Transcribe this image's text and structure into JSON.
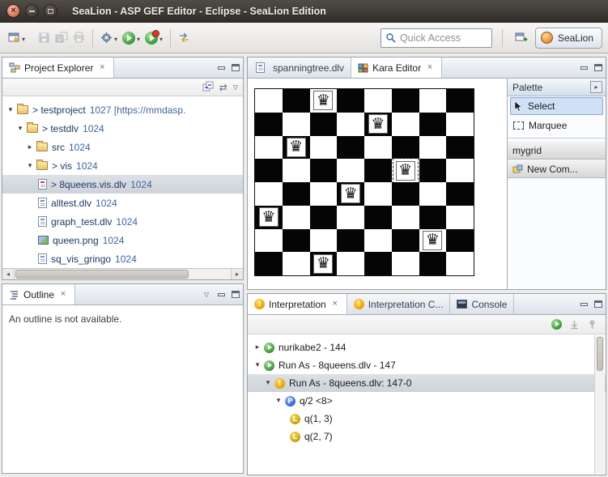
{
  "window": {
    "title": "SeaLion - ASP GEF Editor - Eclipse - SeaLion Edition"
  },
  "toolbar": {
    "quick_access": "Quick Access",
    "perspective": "SeaLion"
  },
  "project_explorer": {
    "title": "Project Explorer",
    "items": [
      {
        "label": "> testproject",
        "decoration": "1027 [https://mmdasp."
      },
      {
        "label": "> testdlv",
        "decoration": "1024"
      },
      {
        "label": "src",
        "decoration": "1024"
      },
      {
        "label": "> vis",
        "decoration": "1024"
      },
      {
        "label": "> 8queens.vis.dlv",
        "decoration": "1024"
      },
      {
        "label": "alltest.dlv",
        "decoration": "1024"
      },
      {
        "label": "graph_test.dlv",
        "decoration": "1024"
      },
      {
        "label": "queen.png",
        "decoration": "1024"
      },
      {
        "label": "sq_vis_gringo",
        "decoration": "1024"
      }
    ]
  },
  "outline": {
    "title": "Outline",
    "message": "An outline is not available."
  },
  "editor": {
    "tabs": [
      {
        "label": "spanningtree.dlv"
      },
      {
        "label": "Kara Editor"
      }
    ],
    "board": {
      "rows": 8,
      "cols": 8,
      "queen_symbol": "♛",
      "queens": [
        {
          "row": 1,
          "col": 3
        },
        {
          "row": 2,
          "col": 5
        },
        {
          "row": 3,
          "col": 2
        },
        {
          "row": 4,
          "col": 6,
          "selected": true
        },
        {
          "row": 5,
          "col": 4
        },
        {
          "row": 6,
          "col": 1
        },
        {
          "row": 7,
          "col": 7
        },
        {
          "row": 8,
          "col": 3
        }
      ]
    }
  },
  "palette": {
    "title": "Palette",
    "tools": [
      {
        "label": "Select"
      },
      {
        "label": "Marquee"
      }
    ],
    "drawers": [
      {
        "label": "mygrid"
      },
      {
        "label": "New Com..."
      }
    ]
  },
  "interpretation": {
    "tabs": [
      {
        "label": "Interpretation"
      },
      {
        "label": "Interpretation C..."
      },
      {
        "label": "Console"
      }
    ],
    "tree": [
      {
        "label": "nurikabe2 - 144"
      },
      {
        "label": "Run As -  8queens.dlv - 147"
      },
      {
        "label": "Run As -  8queens.dlv: 147-0"
      },
      {
        "label": "q/2 <8>"
      },
      {
        "label": "q(1, 3)"
      },
      {
        "label": "q(2, 7)"
      }
    ]
  }
}
